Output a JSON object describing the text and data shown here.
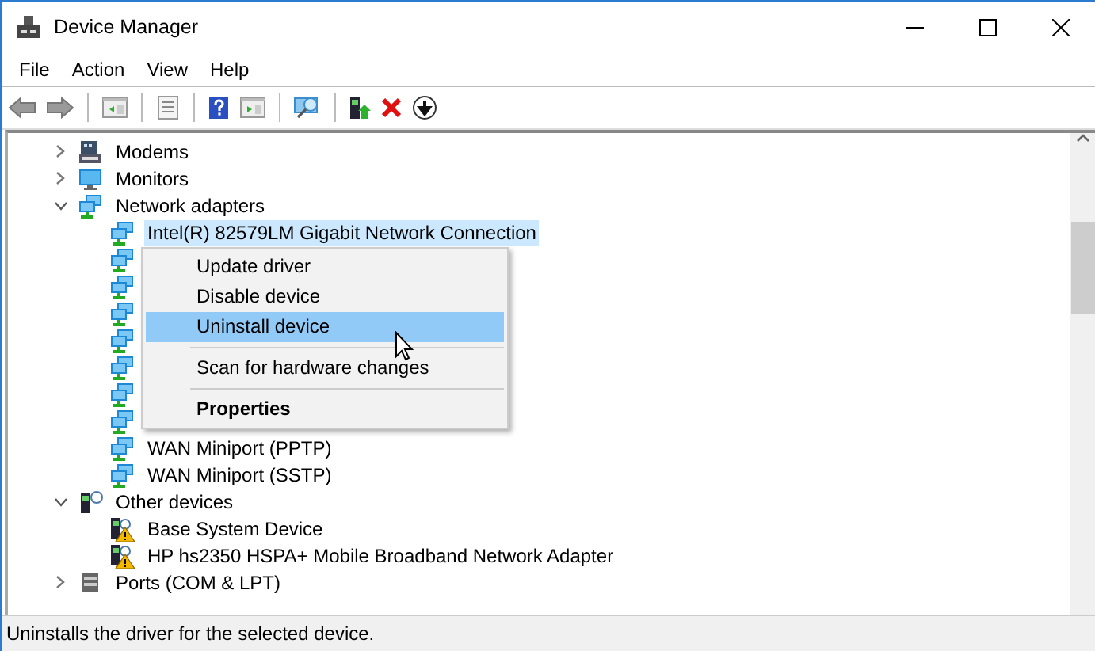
{
  "window": {
    "title": "Device Manager"
  },
  "menu_bar": [
    "File",
    "Action",
    "View",
    "Help"
  ],
  "toolbar": [
    {
      "kind": "back"
    },
    {
      "kind": "forward"
    },
    {
      "kind": "separator"
    },
    {
      "kind": "tree-pane"
    },
    {
      "kind": "separator"
    },
    {
      "kind": "properties"
    },
    {
      "kind": "separator"
    },
    {
      "kind": "help"
    },
    {
      "kind": "action-pane"
    },
    {
      "kind": "separator"
    },
    {
      "kind": "scan"
    },
    {
      "kind": "separator"
    },
    {
      "kind": "update"
    },
    {
      "kind": "uninstall"
    },
    {
      "kind": "download"
    }
  ],
  "tree": [
    {
      "label": "Modems",
      "kind": "modem",
      "expanded": false,
      "selected": false
    },
    {
      "label": "Monitors",
      "kind": "monitor",
      "expanded": false,
      "selected": false
    },
    {
      "label": "Network adapters",
      "kind": "network",
      "expanded": true,
      "selected": false,
      "children": [
        {
          "label": "Intel(R) 82579LM Gigabit Network Connection",
          "kind": "network",
          "selected": true
        },
        {
          "kind": "network",
          "selected": false
        },
        {
          "kind": "network",
          "selected": false
        },
        {
          "kind": "network",
          "selected": false
        },
        {
          "kind": "network",
          "selected": false
        },
        {
          "kind": "network",
          "selected": false
        },
        {
          "kind": "network",
          "selected": false
        },
        {
          "kind": "network",
          "selected": false
        },
        {
          "label": "WAN Miniport (PPTP)",
          "kind": "network",
          "selected": false
        },
        {
          "label": "WAN Miniport (SSTP)",
          "kind": "network",
          "selected": false
        }
      ]
    },
    {
      "label": "Other devices",
      "kind": "unknown",
      "expanded": true,
      "selected": false,
      "children": [
        {
          "label": "Base System Device",
          "kind": "warning",
          "selected": false
        },
        {
          "label": "HP hs2350 HSPA+ Mobile Broadband Network Adapter",
          "kind": "warning",
          "selected": false
        }
      ]
    },
    {
      "label": "Ports (COM & LPT)",
      "kind": "port",
      "expanded": false,
      "selected": false
    }
  ],
  "context_menu": [
    {
      "kind": "item",
      "label": "Update driver",
      "selected": false
    },
    {
      "kind": "item",
      "label": "Disable device",
      "selected": false
    },
    {
      "kind": "item",
      "label": "Uninstall device",
      "selected": true
    },
    {
      "kind": "separator"
    },
    {
      "kind": "item",
      "label": "Scan for hardware changes",
      "selected": false
    },
    {
      "kind": "separator"
    },
    {
      "kind": "default",
      "label": "Properties",
      "selected": false
    }
  ],
  "status_bar": {
    "text": "Uninstalls the driver for the selected device."
  }
}
